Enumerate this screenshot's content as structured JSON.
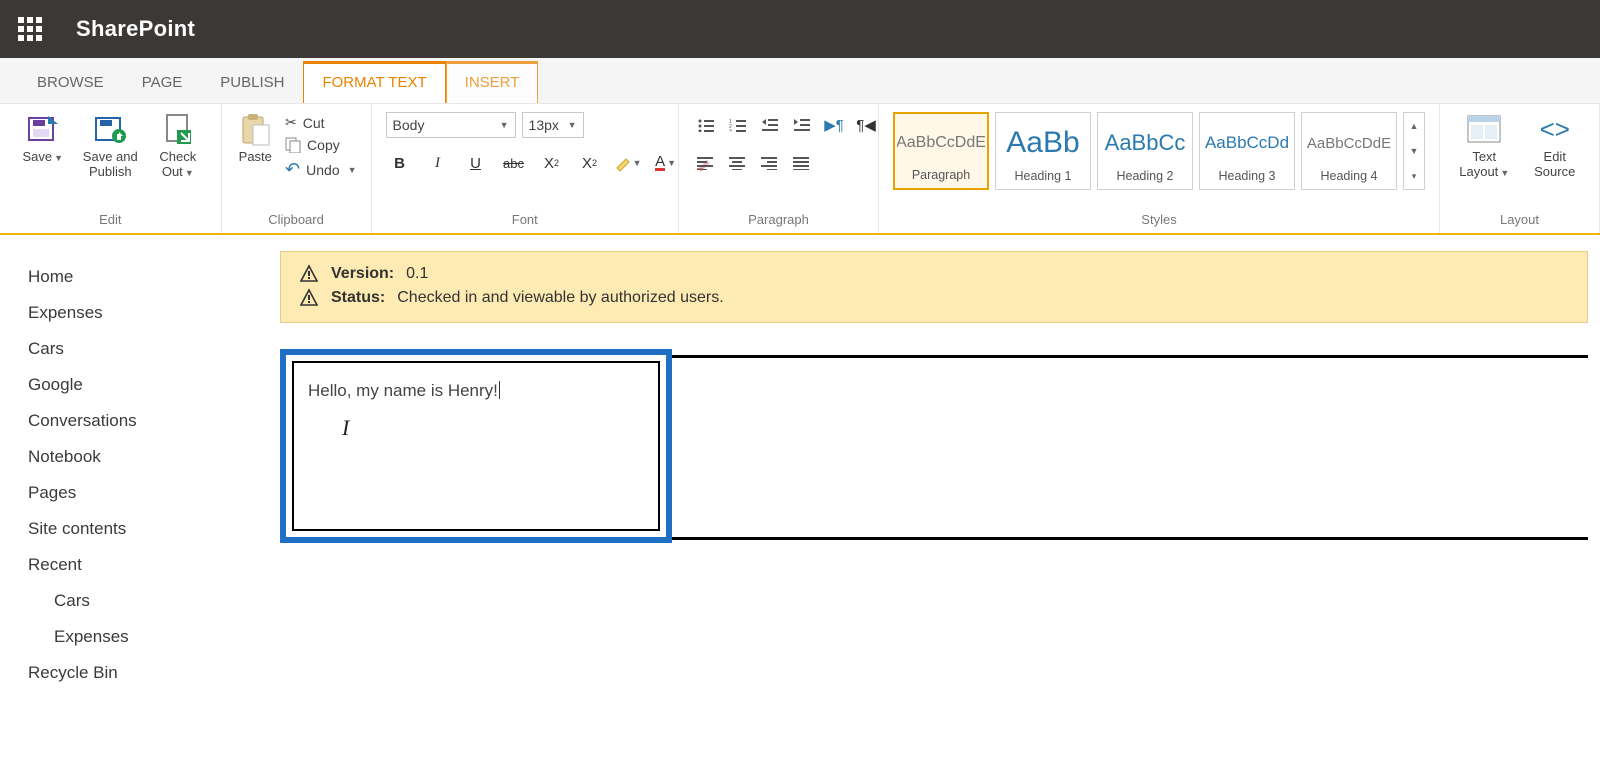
{
  "suite": {
    "app": "SharePoint"
  },
  "tabs": {
    "browse": "BROWSE",
    "page": "PAGE",
    "publish": "PUBLISH",
    "format": "FORMAT TEXT",
    "insert": "INSERT",
    "active": "format"
  },
  "ribbon": {
    "edit": {
      "save": "Save",
      "save_publish": "Save and\nPublish",
      "checkout": "Check Out",
      "group": "Edit"
    },
    "clip": {
      "paste": "Paste",
      "cut": "Cut",
      "copy": "Copy",
      "undo": "Undo",
      "group": "Clipboard"
    },
    "font": {
      "name": "Body",
      "size": "13px",
      "group": "Font"
    },
    "para": {
      "group": "Paragraph"
    },
    "styles": {
      "group": "Styles",
      "items": [
        {
          "preview": "AaBbCcDdE",
          "name": "Paragraph",
          "selected": true,
          "color": "#777",
          "size": "16px"
        },
        {
          "preview": "AaBb",
          "name": "Heading 1",
          "color": "#2a7ab0",
          "size": "30px"
        },
        {
          "preview": "AaBbCc",
          "name": "Heading 2",
          "color": "#2a7ab0",
          "size": "22px"
        },
        {
          "preview": "AaBbCcDd",
          "name": "Heading 3",
          "color": "#2a7ab0",
          "size": "17px"
        },
        {
          "preview": "AaBbCcDdE",
          "name": "Heading 4",
          "color": "#777",
          "size": "15px"
        }
      ]
    },
    "layout": {
      "text_layout": "Text\nLayout",
      "edit_source": "Edit\nSource",
      "group": "Layout"
    }
  },
  "sidenav": {
    "items": [
      "Home",
      "Expenses",
      "Cars",
      "Google",
      "Conversations",
      "Notebook",
      "Pages",
      "Site contents",
      "Recent"
    ],
    "recent_children": [
      "Cars",
      "Expenses"
    ],
    "recycle": "Recycle Bin"
  },
  "status": {
    "version_label": "Version:",
    "version_value": "0.1",
    "status_label": "Status:",
    "status_value": "Checked in and viewable by authorized users."
  },
  "editor": {
    "text": "Hello, my name is Henry!"
  }
}
